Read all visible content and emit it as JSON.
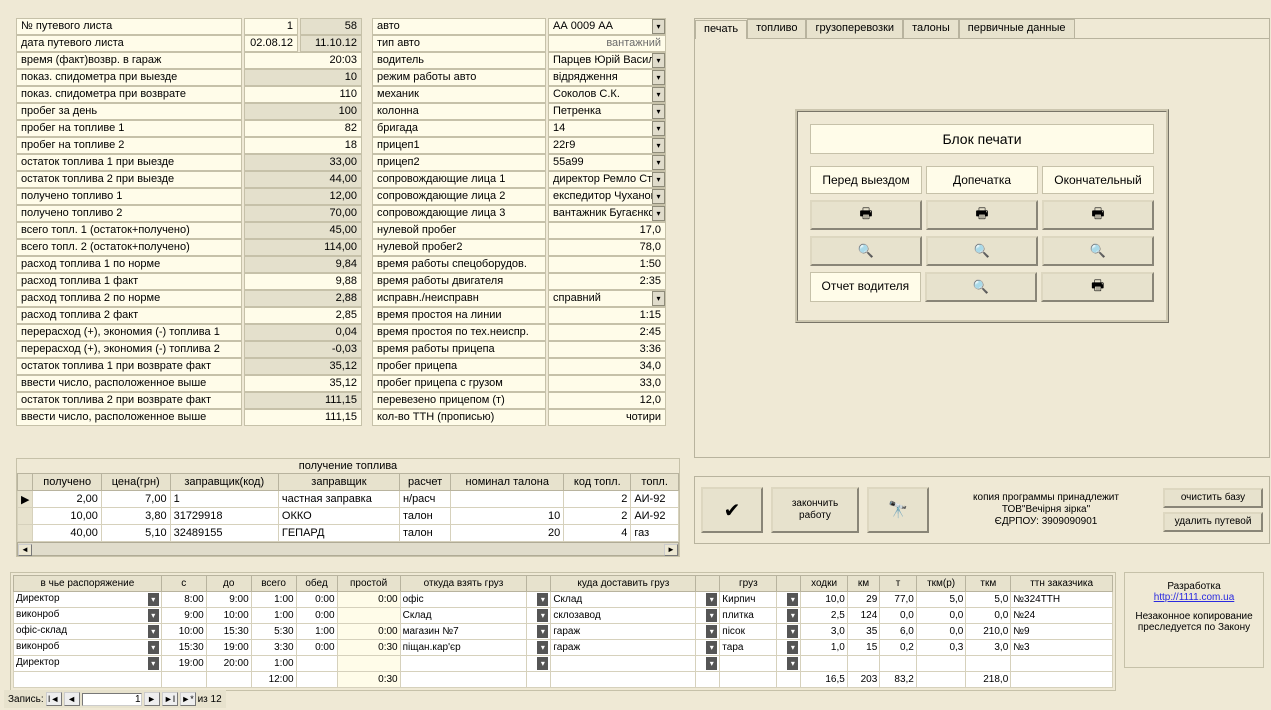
{
  "left_fields": [
    {
      "label": "№ путевого листа",
      "c1": "1",
      "c2": "58",
      "c1Class": "lv-yellow"
    },
    {
      "label": "дата путевого листа",
      "c1": "02.08.12",
      "c2": "11.10.12",
      "c1Class": "lv-yellow"
    },
    {
      "label": "время (факт)возвр. в гараж",
      "c1": "",
      "c2": "20:03",
      "c2Class": "lv-yellow"
    },
    {
      "label": "показ. спидометра при выезде",
      "c1": "",
      "c2": "10"
    },
    {
      "label": "показ. спидометра при возврате",
      "c1": "",
      "c2": "110",
      "c2Class": "lv-yellow"
    },
    {
      "label": "пробег за день",
      "c1": "",
      "c2": "100"
    },
    {
      "label": "пробег на топливе 1",
      "c1": "",
      "c2": "82",
      "c2Class": "lv-yellow"
    },
    {
      "label": "пробег на топливе 2",
      "c1": "",
      "c2": "18",
      "c2Class": "lv-yellow"
    },
    {
      "label": "остаток  топлива 1 при выезде",
      "c1": "",
      "c2": "33,00"
    },
    {
      "label": "остаток топлива 2 при выезде",
      "c1": "",
      "c2": "44,00"
    },
    {
      "label": "получено топливо 1",
      "c1": "",
      "c2": "12,00"
    },
    {
      "label": "получено топливо 2",
      "c1": "",
      "c2": "70,00"
    },
    {
      "label": "всего топл. 1 (остаток+получено)",
      "c1": "",
      "c2": "45,00"
    },
    {
      "label": "всего топл. 2 (остаток+получено)",
      "c1": "",
      "c2": "114,00"
    },
    {
      "label": "расход топлива 1 по норме",
      "c1": "",
      "c2": "9,84"
    },
    {
      "label": "расход топлива 1 факт",
      "c1": "",
      "c2": "9,88",
      "c2Class": "lv-yellow"
    },
    {
      "label": "расход топлива 2 по норме",
      "c1": "",
      "c2": "2,88"
    },
    {
      "label": "расход топлива 2 факт",
      "c1": "",
      "c2": "2,85",
      "c2Class": "lv-yellow"
    },
    {
      "label": "перерасход (+), экономия (-) топлива 1",
      "c1": "",
      "c2": "0,04"
    },
    {
      "label": "перерасход (+), экономия (-) топлива 2",
      "c1": "",
      "c2": "-0,03"
    },
    {
      "label": "остаток топлива 1 при возврате факт",
      "c1": "",
      "c2": "35,12"
    },
    {
      "label": "ввести число, расположенное выше",
      "c1": "",
      "c2": "35,12",
      "c2Class": "lv-yellow"
    },
    {
      "label": "остаток топлива 2 при возврате факт",
      "c1": "",
      "c2": "111,15"
    },
    {
      "label": "ввести число, расположенное выше",
      "c1": "",
      "c2": "111,15",
      "c2Class": "lv-yellow"
    }
  ],
  "mid_fields": [
    {
      "label": "авто",
      "val": "АА 0009 АА",
      "dd": true
    },
    {
      "label": "тип авто",
      "val": "вантажний",
      "gray": true
    },
    {
      "label": "водитель",
      "val": "Парцев Юрій Василь",
      "dd": true
    },
    {
      "label": "режим работы авто",
      "val": "відрядження",
      "dd": true
    },
    {
      "label": "механик",
      "val": "Соколов С.К.",
      "dd": true
    },
    {
      "label": "колонна",
      "val": "Петренка",
      "dd": true
    },
    {
      "label": "бригада",
      "val": "14",
      "dd": true
    },
    {
      "label": "прицеп1",
      "val": "22г9",
      "dd": true
    },
    {
      "label": "прицеп2",
      "val": "55а99",
      "dd": true
    },
    {
      "label": "сопровождающие  лица 1",
      "val": "директор Ремло Степ",
      "dd": true
    },
    {
      "label": "сопровождающие лица 2",
      "val": "експедитор Чуханов І",
      "dd": true
    },
    {
      "label": "сопровождающие лица 3",
      "val": "вантажник Бугаєнко",
      "dd": true
    },
    {
      "label": "нулевой пробег",
      "val": "17,0",
      "right": true
    },
    {
      "label": "нулевой пробег2",
      "val": "78,0",
      "right": true
    },
    {
      "label": "время работы спецоборудов.",
      "val": "1:50",
      "right": true
    },
    {
      "label": "время работы двигателя",
      "val": "2:35",
      "right": true
    },
    {
      "label": "исправн./неисправн",
      "val": "справний",
      "dd": true
    },
    {
      "label": "время простоя на линии",
      "val": "1:15",
      "right": true
    },
    {
      "label": "время простоя по тех.неиспр.",
      "val": "2:45",
      "right": true
    },
    {
      "label": "время работы прицепа",
      "val": "3:36",
      "right": true
    },
    {
      "label": "пробег прицепа",
      "val": "34,0",
      "right": true
    },
    {
      "label": "пробег прицепа с грузом",
      "val": "33,0",
      "right": true
    },
    {
      "label": "перевезено прицепом (т)",
      "val": "12,0",
      "right": true
    },
    {
      "label": "кол-во ТТН (прописью)",
      "val": "чотири",
      "right": true
    }
  ],
  "fuel": {
    "title": "получение топлива",
    "headers": [
      "",
      "получено",
      "цена(грн)",
      "заправщик(код)",
      "заправщик",
      "расчет",
      "номинал талона",
      "код топл.",
      "топл."
    ],
    "rows": [
      {
        "mark": "▶",
        "r": [
          "2,00",
          "7,00",
          "1",
          "частная заправка",
          "н/расч",
          "",
          "2",
          "АИ-92"
        ]
      },
      {
        "mark": "",
        "r": [
          "10,00",
          "3,80",
          "31729918",
          "ОККО",
          "талон",
          "10",
          "2",
          "АИ-92"
        ]
      },
      {
        "mark": "",
        "r": [
          "40,00",
          "5,10",
          "32489155",
          "ГЕПАРД",
          "талон",
          "20",
          "4",
          "газ"
        ]
      }
    ]
  },
  "assign": {
    "headers": [
      "в чье распоряжение",
      "с",
      "до",
      "всего",
      "обед",
      "простой",
      "откуда взять груз",
      "",
      "куда доставить груз",
      "",
      "груз",
      "",
      "ходки",
      "км",
      "т",
      "ткм(р)",
      "ткм",
      "ттн заказчика"
    ],
    "rows": [
      {
        "who": "Директор",
        "s": "8:00",
        "do": "9:00",
        "vs": "1:00",
        "ob": "0:00",
        "pr": "0:00",
        "from": "офіс",
        "fdd": true,
        "to": "Склад",
        "tdd": true,
        "gruz": "Кирпич",
        "gdd": true,
        "hod": "10,0",
        "km": "29",
        "t": "77,0",
        "tkmr": "5,0",
        "tkm": "5,0",
        "ttn": "№324ТТН"
      },
      {
        "who": "виконроб",
        "s": "9:00",
        "do": "10:00",
        "vs": "1:00",
        "ob": "0:00",
        "pr": "",
        "from": "Склад",
        "fdd": true,
        "to": "склозавод",
        "tdd": true,
        "gruz": "плитка",
        "gdd": true,
        "hod": "2,5",
        "km": "124",
        "t": "0,0",
        "tkmr": "0,0",
        "tkm": "0,0",
        "ttn": "№24"
      },
      {
        "who": "офіс-склад",
        "s": "10:00",
        "do": "15:30",
        "vs": "5:30",
        "ob": "1:00",
        "pr": "0:00",
        "from": "магазин №7",
        "fdd": true,
        "to": "гараж",
        "tdd": true,
        "gruz": "пісок",
        "gdd": true,
        "hod": "3,0",
        "km": "35",
        "t": "6,0",
        "tkmr": "0,0",
        "tkm": "210,0",
        "ttn": "№9"
      },
      {
        "who": "виконроб",
        "s": "15:30",
        "do": "19:00",
        "vs": "3:30",
        "ob": "0:00",
        "pr": "0:30",
        "from": "піщан.кар'єр",
        "fdd": true,
        "to": "гараж",
        "tdd": true,
        "gruz": "тара",
        "gdd": true,
        "hod": "1,0",
        "km": "15",
        "t": "0,2",
        "tkmr": "0,3",
        "tkm": "3,0",
        "ttn": "№3"
      },
      {
        "who": "Директор",
        "s": "19:00",
        "do": "20:00",
        "vs": "1:00",
        "ob": "",
        "pr": "",
        "from": "",
        "fdd": true,
        "to": "",
        "tdd": true,
        "gruz": "",
        "gdd": true,
        "hod": "",
        "km": "",
        "t": "",
        "tkmr": "",
        "tkm": "",
        "ttn": ""
      }
    ],
    "totals": {
      "vs": "12:00",
      "pr": "0:30",
      "hod": "16,5",
      "km": "203",
      "t": "83,2",
      "tkm": "218,0"
    }
  },
  "tabs": [
    "печать",
    "топливо",
    "грузоперевозки",
    "талоны",
    "первичные данные"
  ],
  "print_block": {
    "title": "Блок печати",
    "cols": [
      "Перед выездом",
      "Допечатка",
      "Окончательный"
    ],
    "report_driver": "Отчет водителя"
  },
  "footer": {
    "finish": "закончить\nработу",
    "copy": "копия программы принадлежит\nТОВ\"Вечірня зірка\"\nЄДРПОУ: 3909090901",
    "clear": "очистить базу",
    "delete": "удалить путевой"
  },
  "credits": {
    "l1": "Разработка",
    "link": "http://1111.com.ua",
    "l2": "Незаконное копирование преследуется по Закону"
  },
  "recnav": {
    "label": "Запись:",
    "value": "1",
    "of": "из  12"
  }
}
